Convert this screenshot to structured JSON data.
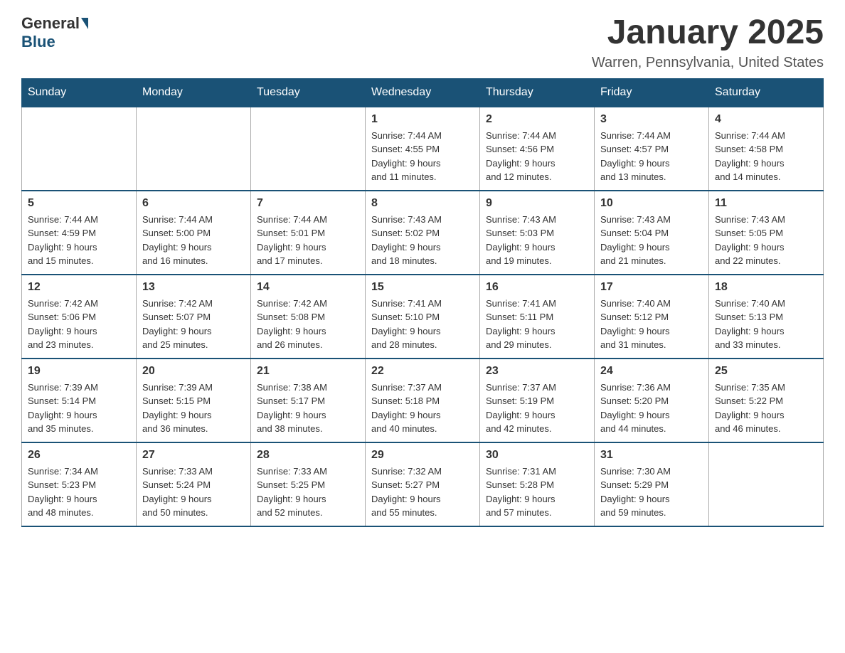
{
  "header": {
    "logo": {
      "general": "General",
      "blue": "Blue"
    },
    "title": "January 2025",
    "location": "Warren, Pennsylvania, United States"
  },
  "weekdays": [
    "Sunday",
    "Monday",
    "Tuesday",
    "Wednesday",
    "Thursday",
    "Friday",
    "Saturday"
  ],
  "weeks": [
    [
      {
        "day": "",
        "info": ""
      },
      {
        "day": "",
        "info": ""
      },
      {
        "day": "",
        "info": ""
      },
      {
        "day": "1",
        "info": "Sunrise: 7:44 AM\nSunset: 4:55 PM\nDaylight: 9 hours\nand 11 minutes."
      },
      {
        "day": "2",
        "info": "Sunrise: 7:44 AM\nSunset: 4:56 PM\nDaylight: 9 hours\nand 12 minutes."
      },
      {
        "day": "3",
        "info": "Sunrise: 7:44 AM\nSunset: 4:57 PM\nDaylight: 9 hours\nand 13 minutes."
      },
      {
        "day": "4",
        "info": "Sunrise: 7:44 AM\nSunset: 4:58 PM\nDaylight: 9 hours\nand 14 minutes."
      }
    ],
    [
      {
        "day": "5",
        "info": "Sunrise: 7:44 AM\nSunset: 4:59 PM\nDaylight: 9 hours\nand 15 minutes."
      },
      {
        "day": "6",
        "info": "Sunrise: 7:44 AM\nSunset: 5:00 PM\nDaylight: 9 hours\nand 16 minutes."
      },
      {
        "day": "7",
        "info": "Sunrise: 7:44 AM\nSunset: 5:01 PM\nDaylight: 9 hours\nand 17 minutes."
      },
      {
        "day": "8",
        "info": "Sunrise: 7:43 AM\nSunset: 5:02 PM\nDaylight: 9 hours\nand 18 minutes."
      },
      {
        "day": "9",
        "info": "Sunrise: 7:43 AM\nSunset: 5:03 PM\nDaylight: 9 hours\nand 19 minutes."
      },
      {
        "day": "10",
        "info": "Sunrise: 7:43 AM\nSunset: 5:04 PM\nDaylight: 9 hours\nand 21 minutes."
      },
      {
        "day": "11",
        "info": "Sunrise: 7:43 AM\nSunset: 5:05 PM\nDaylight: 9 hours\nand 22 minutes."
      }
    ],
    [
      {
        "day": "12",
        "info": "Sunrise: 7:42 AM\nSunset: 5:06 PM\nDaylight: 9 hours\nand 23 minutes."
      },
      {
        "day": "13",
        "info": "Sunrise: 7:42 AM\nSunset: 5:07 PM\nDaylight: 9 hours\nand 25 minutes."
      },
      {
        "day": "14",
        "info": "Sunrise: 7:42 AM\nSunset: 5:08 PM\nDaylight: 9 hours\nand 26 minutes."
      },
      {
        "day": "15",
        "info": "Sunrise: 7:41 AM\nSunset: 5:10 PM\nDaylight: 9 hours\nand 28 minutes."
      },
      {
        "day": "16",
        "info": "Sunrise: 7:41 AM\nSunset: 5:11 PM\nDaylight: 9 hours\nand 29 minutes."
      },
      {
        "day": "17",
        "info": "Sunrise: 7:40 AM\nSunset: 5:12 PM\nDaylight: 9 hours\nand 31 minutes."
      },
      {
        "day": "18",
        "info": "Sunrise: 7:40 AM\nSunset: 5:13 PM\nDaylight: 9 hours\nand 33 minutes."
      }
    ],
    [
      {
        "day": "19",
        "info": "Sunrise: 7:39 AM\nSunset: 5:14 PM\nDaylight: 9 hours\nand 35 minutes."
      },
      {
        "day": "20",
        "info": "Sunrise: 7:39 AM\nSunset: 5:15 PM\nDaylight: 9 hours\nand 36 minutes."
      },
      {
        "day": "21",
        "info": "Sunrise: 7:38 AM\nSunset: 5:17 PM\nDaylight: 9 hours\nand 38 minutes."
      },
      {
        "day": "22",
        "info": "Sunrise: 7:37 AM\nSunset: 5:18 PM\nDaylight: 9 hours\nand 40 minutes."
      },
      {
        "day": "23",
        "info": "Sunrise: 7:37 AM\nSunset: 5:19 PM\nDaylight: 9 hours\nand 42 minutes."
      },
      {
        "day": "24",
        "info": "Sunrise: 7:36 AM\nSunset: 5:20 PM\nDaylight: 9 hours\nand 44 minutes."
      },
      {
        "day": "25",
        "info": "Sunrise: 7:35 AM\nSunset: 5:22 PM\nDaylight: 9 hours\nand 46 minutes."
      }
    ],
    [
      {
        "day": "26",
        "info": "Sunrise: 7:34 AM\nSunset: 5:23 PM\nDaylight: 9 hours\nand 48 minutes."
      },
      {
        "day": "27",
        "info": "Sunrise: 7:33 AM\nSunset: 5:24 PM\nDaylight: 9 hours\nand 50 minutes."
      },
      {
        "day": "28",
        "info": "Sunrise: 7:33 AM\nSunset: 5:25 PM\nDaylight: 9 hours\nand 52 minutes."
      },
      {
        "day": "29",
        "info": "Sunrise: 7:32 AM\nSunset: 5:27 PM\nDaylight: 9 hours\nand 55 minutes."
      },
      {
        "day": "30",
        "info": "Sunrise: 7:31 AM\nSunset: 5:28 PM\nDaylight: 9 hours\nand 57 minutes."
      },
      {
        "day": "31",
        "info": "Sunrise: 7:30 AM\nSunset: 5:29 PM\nDaylight: 9 hours\nand 59 minutes."
      },
      {
        "day": "",
        "info": ""
      }
    ]
  ]
}
